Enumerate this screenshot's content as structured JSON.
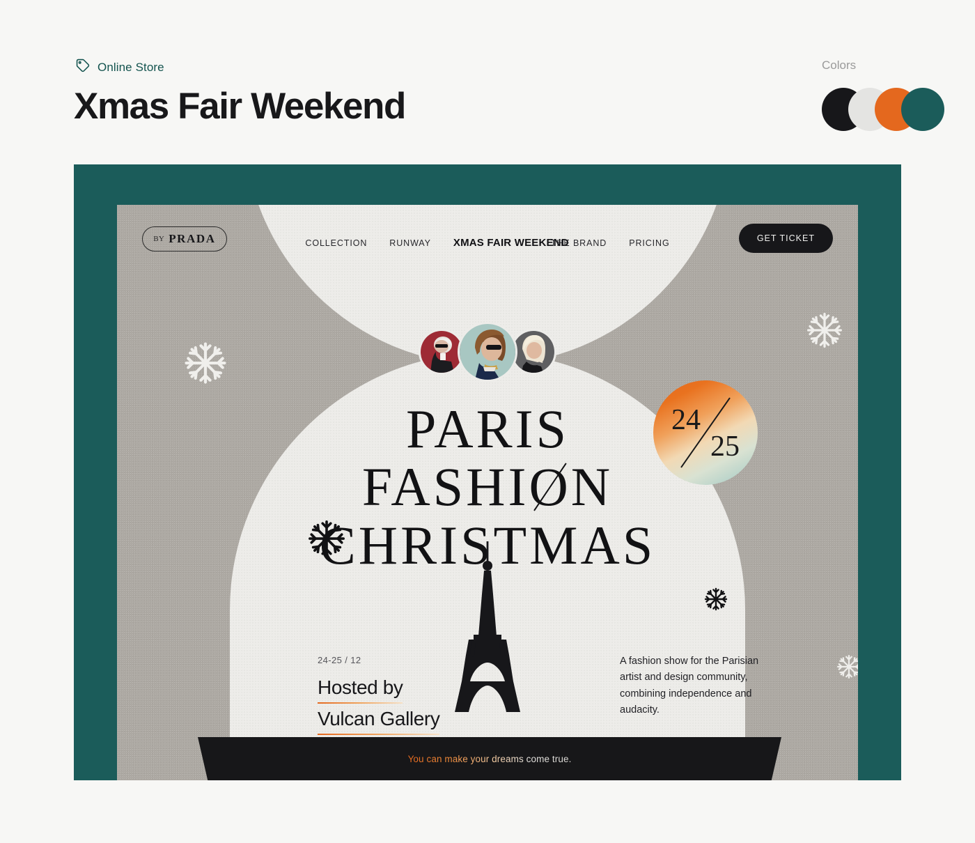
{
  "header": {
    "breadcrumb_icon": "tag-icon",
    "breadcrumb_label": "Online Store",
    "title": "Xmas Fair Weekend",
    "colors_label": "Colors",
    "swatches": [
      "#17171A",
      "#E4E4E2",
      "#E4681E",
      "#1B5C5A"
    ]
  },
  "poster": {
    "frame_color": "#1B5C5A",
    "canvas_color": "#ADA9A3",
    "arch_color": "#EDECE9",
    "nav": {
      "brand_prefix": "BY",
      "brand_name": "PRADA",
      "links": [
        {
          "label": "COLLECTION",
          "active": false
        },
        {
          "label": "RUNWAY",
          "active": false
        },
        {
          "label": "XMAS FAIR WEEKEND",
          "active": true
        },
        {
          "label": "THE BRAND",
          "active": false
        },
        {
          "label": "PRICING",
          "active": false
        }
      ],
      "cta_label": "GET TICKET"
    },
    "avatars": [
      {
        "name": "avatar-karl",
        "bg": "#9E2B35"
      },
      {
        "name": "avatar-anna",
        "bg": "#A8C7C2"
      },
      {
        "name": "avatar-donatella",
        "bg": "#5F5F61"
      }
    ],
    "date_badge": {
      "top": "24",
      "bottom": "25"
    },
    "hero": {
      "line1": "PARIS",
      "line2_a": "FASHI",
      "line2_o": "O",
      "line2_b": "N",
      "line3": "CHRISTMAS"
    },
    "info_left": {
      "date": "24-25 / 12",
      "hosted_line1": "Hosted by",
      "hosted_line2": "Vulcan Gallery"
    },
    "info_right": "A fashion show for the Parisian artist and design community, combining independence and audacity.",
    "ticker": "You can make your dreams come true."
  }
}
